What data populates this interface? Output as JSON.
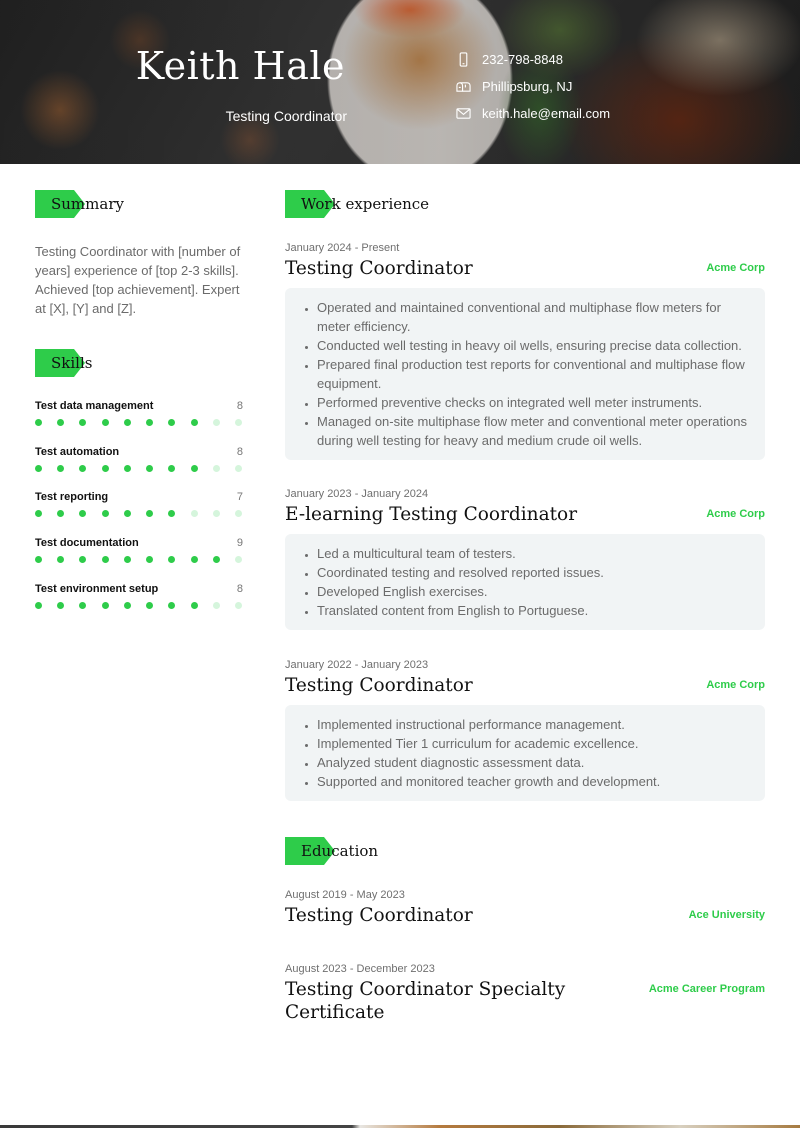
{
  "header": {
    "name": "Keith Hale",
    "role": "Testing Coordinator",
    "contact": [
      {
        "icon": "phone-icon",
        "text": "232-798-8848"
      },
      {
        "icon": "mailbox-icon",
        "text": "Phillipsburg, NJ"
      },
      {
        "icon": "envelope-icon",
        "text": "keith.hale@email.com"
      }
    ]
  },
  "theme": {
    "accent": "#2ecc4a",
    "accent_light": "#d5f5dc",
    "box_bg": "#f1f4f5"
  },
  "summary": {
    "heading": "Summary",
    "text": "Testing Coordinator with [number of years] experience of [top 2-3 skills]. Achieved [top achievement]. Expert at [X], [Y] and [Z]."
  },
  "skills": {
    "heading": "Skills",
    "max": 10,
    "items": [
      {
        "name": "Test data management",
        "value": 8
      },
      {
        "name": "Test automation",
        "value": 8
      },
      {
        "name": "Test reporting",
        "value": 7
      },
      {
        "name": "Test documentation",
        "value": 9
      },
      {
        "name": "Test environment setup",
        "value": 8
      }
    ]
  },
  "work": {
    "heading": "Work experience",
    "items": [
      {
        "date": "January 2024 - Present",
        "title": "Testing Coordinator",
        "org": "Acme Corp",
        "bullets": [
          "Operated and maintained conventional and multiphase flow meters for meter efficiency.",
          "Conducted well testing in heavy oil wells, ensuring precise data collection.",
          "Prepared final production test reports for conventional and multiphase flow equipment.",
          "Performed preventive checks on integrated well meter instruments.",
          "Managed on-site multiphase flow meter and conventional meter operations during well testing for heavy and medium crude oil wells."
        ]
      },
      {
        "date": "January 2023 - January 2024",
        "title": "E-learning Testing Coordinator",
        "org": "Acme Corp",
        "bullets": [
          "Led a multicultural team of testers.",
          "Coordinated testing and resolved reported issues.",
          "Developed English exercises.",
          "Translated content from English to Portuguese."
        ]
      },
      {
        "date": "January 2022 - January 2023",
        "title": "Testing Coordinator",
        "org": "Acme Corp",
        "bullets": [
          "Implemented instructional performance management.",
          "Implemented Tier 1 curriculum for academic excellence.",
          "Analyzed student diagnostic assessment data.",
          "Supported and monitored teacher growth and development."
        ]
      }
    ]
  },
  "education": {
    "heading": "Education",
    "items": [
      {
        "date": "August 2019 - May 2023",
        "title": "Testing Coordinator",
        "org": "Ace University"
      },
      {
        "date": "August 2023 - December 2023",
        "title": "Testing Coordinator Specialty Certificate",
        "org": "Acme Career Program"
      }
    ]
  }
}
